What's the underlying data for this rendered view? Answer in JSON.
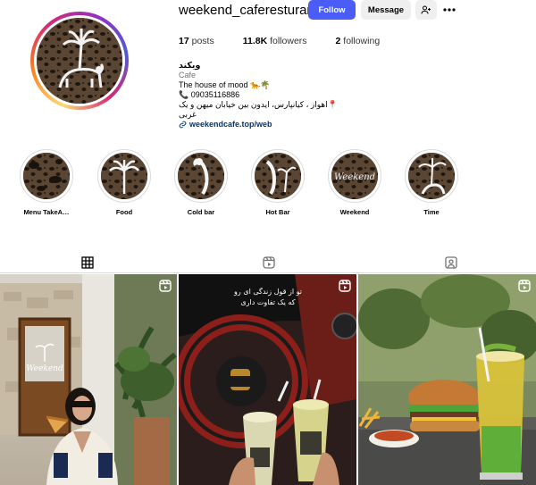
{
  "profile": {
    "username": "weekend_caferesturant",
    "follow_label": "Follow",
    "message_label": "Message",
    "stats": {
      "posts_count": "17",
      "posts_label": "posts",
      "followers_count": "11.8K",
      "followers_label": "followers",
      "following_count": "2",
      "following_label": "following"
    },
    "bio": {
      "name": "ویکند",
      "category": "Cafe",
      "line1": "The house of mood 🐆🌴",
      "phone": "📞 09035116886",
      "address": "📍اهواز ، کیانپارس، ایدون بین خیابان میهن و یک غربی",
      "link": "weekendcafe.top/web"
    }
  },
  "highlights": [
    {
      "label": "Menu TakeA…",
      "icon": "leopard-print"
    },
    {
      "label": "Food",
      "icon": "palm-tree"
    },
    {
      "label": "Cold bar",
      "icon": "leopard"
    },
    {
      "label": "Hot Bar",
      "icon": "leopard-palm"
    },
    {
      "label": "Weekend",
      "icon": "weekend-script"
    },
    {
      "label": "Time",
      "icon": "palm-leopard"
    }
  ],
  "tabs": [
    {
      "name": "posts-tab",
      "icon": "grid-icon",
      "active": true
    },
    {
      "name": "reels-tab",
      "icon": "reels-icon",
      "active": false
    },
    {
      "name": "tagged-tab",
      "icon": "tagged-icon",
      "active": false
    }
  ],
  "posts": [
    {
      "name": "post-woman-eating",
      "has_reel_icon": true
    },
    {
      "name": "post-car-drinks",
      "overlay_text": "تو از قول زندگی ای رو\nکه یک تفاوت داری",
      "has_reel_icon": true
    },
    {
      "name": "post-burger-drink",
      "has_reel_icon": true
    }
  ],
  "colors": {
    "follow_button": "#4a5df9",
    "secondary_button": "#efefef",
    "link": "#00376b",
    "muted": "#737373"
  }
}
